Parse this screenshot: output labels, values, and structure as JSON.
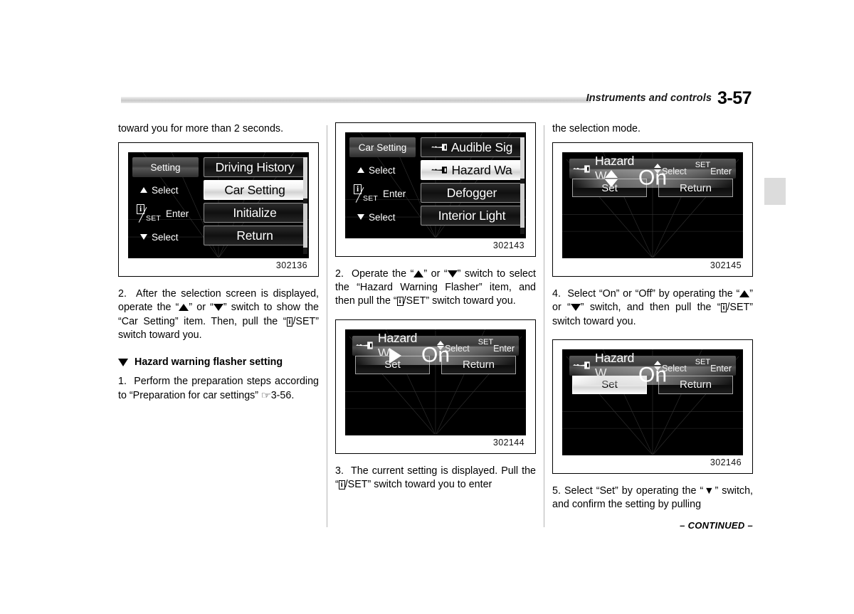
{
  "header": {
    "title": "Instruments and controls",
    "page_number": "3-57"
  },
  "footer": {
    "continued": "– CONTINUED –"
  },
  "columns": {
    "left": {
      "para_top": "toward you for more than 2 seconds.",
      "figure": {
        "number": "302136",
        "screen": {
          "title_button": "Setting",
          "select_up": "Select",
          "enter_label": "Enter",
          "info_glyph": "i",
          "set_glyph": "SET",
          "select_down": "Select",
          "options": [
            {
              "label": "Driving History",
              "selected": false,
              "key_icon": false
            },
            {
              "label": "Car Setting",
              "selected": true,
              "key_icon": false
            },
            {
              "label": "Initialize",
              "selected": false,
              "key_icon": false
            },
            {
              "label": "Return",
              "selected": false,
              "key_icon": false
            }
          ]
        }
      },
      "step_2": "2.  After the selection screen is displayed, operate the “▲” or “▼” switch to show the “Car Setting” item. Then, pull the “ⓘ/SET” switch toward you.",
      "section_heading": "Hazard warning flasher setting",
      "step_1": "1.  Perform the preparation steps according to “Preparation for car settings” ☞3-56."
    },
    "middle": {
      "figure_top": {
        "number": "302143",
        "screen": {
          "title_button": "Car Setting",
          "select_up": "Select",
          "enter_label": "Enter",
          "info_glyph": "i",
          "set_glyph": "SET",
          "select_down": "Select",
          "options": [
            {
              "label": "Audible Sig",
              "selected": false,
              "key_icon": true
            },
            {
              "label": "Hazard Wa",
              "selected": true,
              "key_icon": true
            },
            {
              "label": "Defogger",
              "selected": false,
              "key_icon": false
            },
            {
              "label": "Interior Light",
              "selected": false,
              "key_icon": false
            }
          ]
        }
      },
      "step_2": "2.  Operate the “▲” or “▼” switch to select the “Hazard Warning Flasher” item, and then pull the “ⓘ/SET” switch toward you.",
      "figure_bottom": {
        "number": "302144",
        "screen": {
          "head_name": "Hazard W",
          "head_select": "Select",
          "head_set": "SET",
          "head_enter": "Enter",
          "value": "On",
          "cursor": "play-triangle",
          "btn_set": "Set",
          "btn_return": "Return",
          "btn_selected": "none"
        }
      },
      "step_3": "3.  The current setting is displayed. Pull the “ⓘ/SET” switch toward you to enter"
    },
    "right": {
      "para_top": "the selection mode.",
      "figure_top": {
        "number": "302145",
        "screen": {
          "head_name": "Hazard W",
          "head_select": "Select",
          "head_set": "SET",
          "head_enter": "Enter",
          "value": "On",
          "cursor": "up-down-arrows",
          "btn_set": "Set",
          "btn_return": "Return",
          "btn_selected": "none"
        }
      },
      "step_4": "4.  Select “On” or “Off” by operating the “▲” or “▼” switch, and then pull the “ⓘ/SET” switch toward you.",
      "figure_bottom": {
        "number": "302146",
        "screen": {
          "head_name": "Hazard W",
          "head_select": "Select",
          "head_set": "SET",
          "head_enter": "Enter",
          "value": "On",
          "cursor": "none",
          "btn_set": "Set",
          "btn_return": "Return",
          "btn_selected": "set"
        }
      },
      "step_5": "5.  Select “Set” by operating the “▼” switch, and confirm the setting by pulling"
    }
  }
}
